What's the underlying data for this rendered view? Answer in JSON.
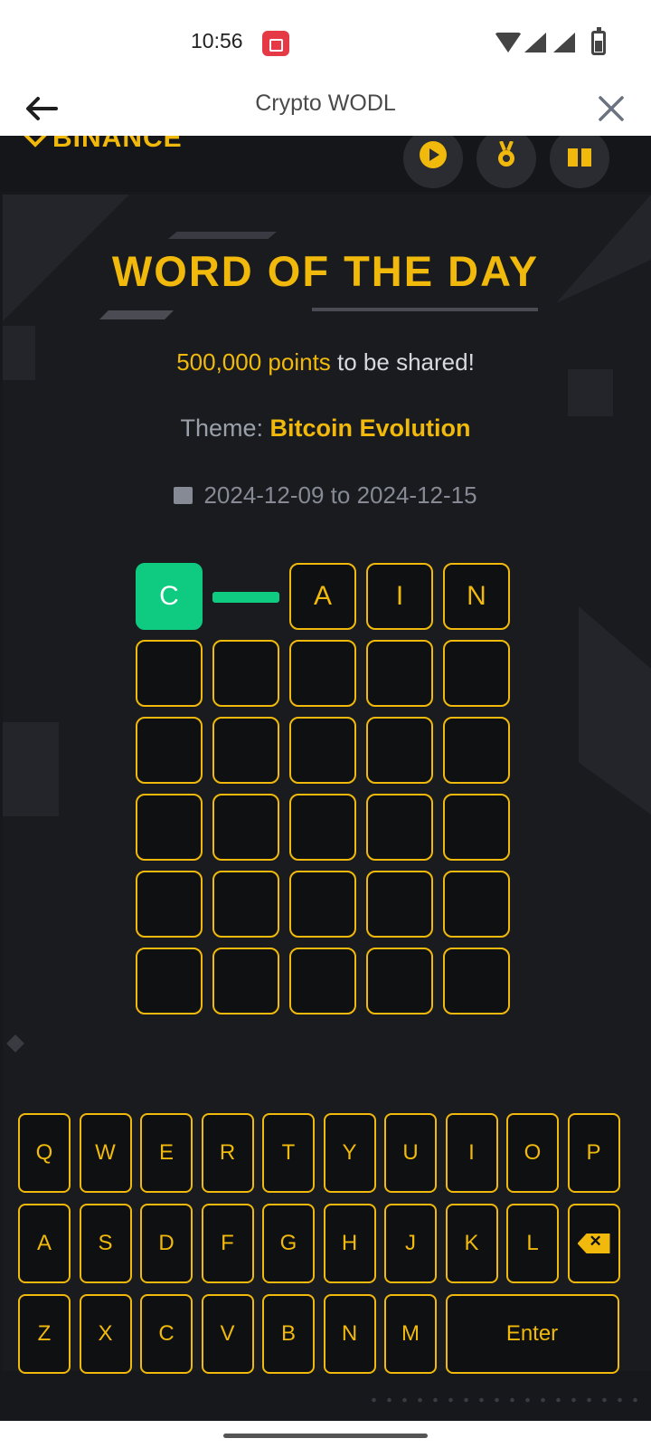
{
  "status_bar": {
    "time": "10:56",
    "icons": [
      "screen-record-icon",
      "wifi-icon",
      "signal-icon",
      "signal-icon",
      "battery-icon"
    ]
  },
  "app_bar": {
    "title": "Crypto WODL",
    "back_icon": "arrow-left-icon",
    "close_icon": "close-icon"
  },
  "game": {
    "logo_text": "BINANCE",
    "header_buttons": [
      "play-icon",
      "medal-icon",
      "gift-icon"
    ],
    "title": "WORD OF THE DAY",
    "points_amount": "500,000",
    "points_unit": "points",
    "points_rest": " to be shared!",
    "theme_label": "Theme: ",
    "theme_value": "Bitcoin Evolution",
    "date_range": "2024-12-09 to 2024-12-15",
    "accent_color": "#f0b90b",
    "correct_color": "#0ecb81",
    "board": [
      [
        {
          "letter": "C",
          "state": "correct"
        },
        {
          "letter": "",
          "state": "flipping"
        },
        {
          "letter": "A",
          "state": "typed"
        },
        {
          "letter": "I",
          "state": "typed"
        },
        {
          "letter": "N",
          "state": "typed"
        }
      ],
      [
        {
          "letter": "",
          "state": "empty"
        },
        {
          "letter": "",
          "state": "empty"
        },
        {
          "letter": "",
          "state": "empty"
        },
        {
          "letter": "",
          "state": "empty"
        },
        {
          "letter": "",
          "state": "empty"
        }
      ],
      [
        {
          "letter": "",
          "state": "empty"
        },
        {
          "letter": "",
          "state": "empty"
        },
        {
          "letter": "",
          "state": "empty"
        },
        {
          "letter": "",
          "state": "empty"
        },
        {
          "letter": "",
          "state": "empty"
        }
      ],
      [
        {
          "letter": "",
          "state": "empty"
        },
        {
          "letter": "",
          "state": "empty"
        },
        {
          "letter": "",
          "state": "empty"
        },
        {
          "letter": "",
          "state": "empty"
        },
        {
          "letter": "",
          "state": "empty"
        }
      ],
      [
        {
          "letter": "",
          "state": "empty"
        },
        {
          "letter": "",
          "state": "empty"
        },
        {
          "letter": "",
          "state": "empty"
        },
        {
          "letter": "",
          "state": "empty"
        },
        {
          "letter": "",
          "state": "empty"
        }
      ],
      [
        {
          "letter": "",
          "state": "empty"
        },
        {
          "letter": "",
          "state": "empty"
        },
        {
          "letter": "",
          "state": "empty"
        },
        {
          "letter": "",
          "state": "empty"
        },
        {
          "letter": "",
          "state": "empty"
        }
      ]
    ],
    "keyboard": [
      [
        "Q",
        "W",
        "E",
        "R",
        "T",
        "Y",
        "U",
        "I",
        "O",
        "P"
      ],
      [
        "A",
        "S",
        "D",
        "F",
        "G",
        "H",
        "J",
        "K",
        "L",
        "backspace-icon"
      ],
      [
        "Z",
        "X",
        "C",
        "V",
        "B",
        "N",
        "M",
        "Enter"
      ]
    ]
  }
}
